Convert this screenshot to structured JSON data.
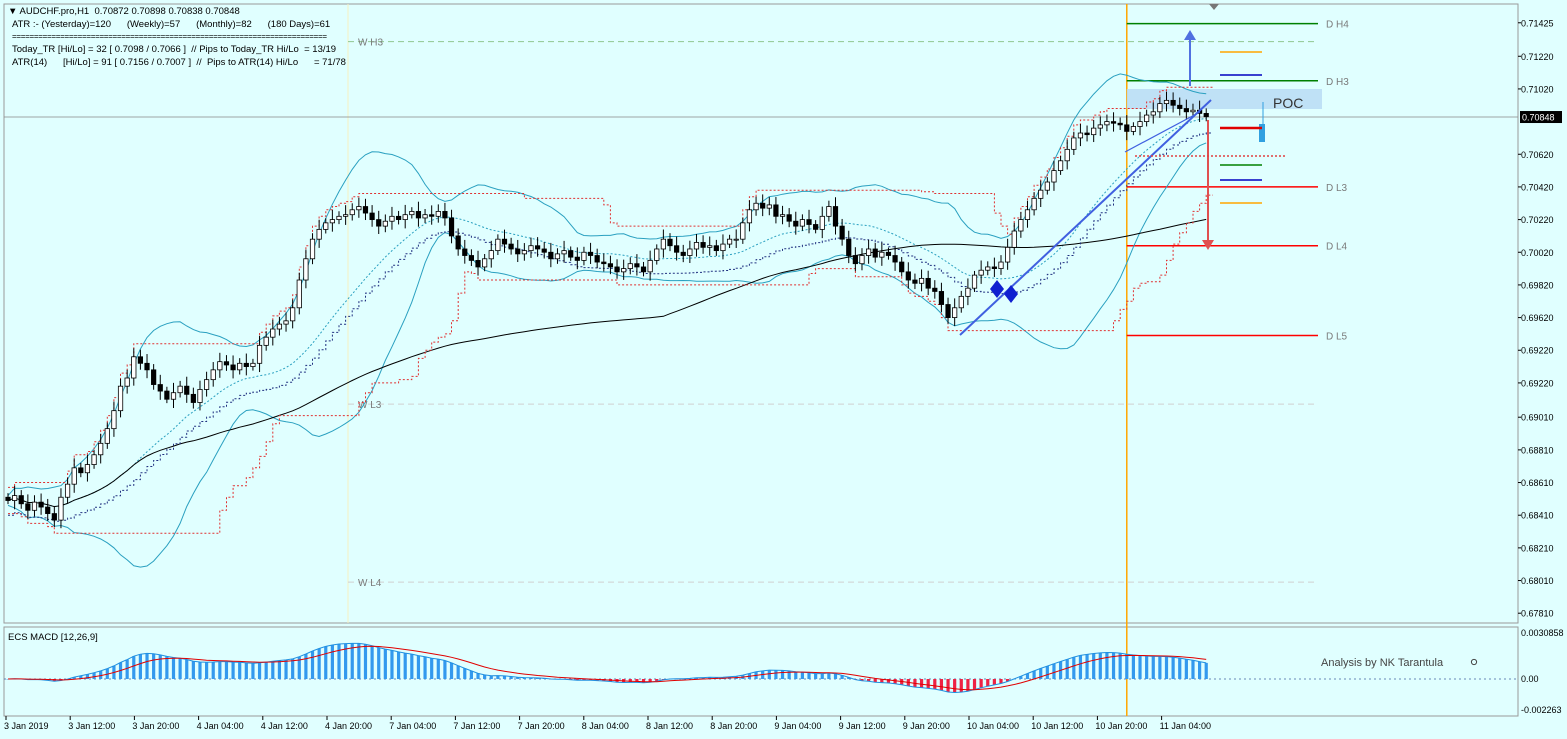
{
  "header": {
    "symbol_line": "AUDCHF.pro,H1  0.70872 0.70898 0.70838 0.70848",
    "atr_line": "ATR :- (Yesterday)=120      (Weekly)=57      (Monthly)=82      (180 Days)=61",
    "separator": "========================================================================",
    "today_tr_line": "Today_TR [Hi/Lo] = 32 [ 0.7098 / 0.7066 ]  // Pips to Today_TR Hi/Lo  = 13/19",
    "atr14_line": "ATR(14)      [Hi/Lo] = 91 [ 0.7156 / 0.7007 ]  //  Pips to ATR(14) Hi/Lo      = 71/78"
  },
  "colors": {
    "background": "#e0ffff",
    "bull_candle": "#ffffff",
    "bear_candle": "#000000",
    "bollinger": "#2aa0c0",
    "envelope_dotted": "#e03030",
    "ma_dark": "#000000",
    "pivot_green": "#008000",
    "pivot_red": "#ff0000",
    "vline_orange": "#ffa500",
    "trendline": "#4060e0",
    "macd_pos": "#3399ee",
    "macd_neg": "#ee2244",
    "poc_zone": "#b8dcf4"
  },
  "chart_data": [
    {
      "type": "candlestick",
      "symbol": "AUDCHF.pro",
      "timeframe": "H1",
      "ylim": [
        0.6775,
        0.7154
      ],
      "y_ticks": [
        0.71425,
        0.7122,
        0.7102,
        0.70848,
        0.7062,
        0.7042,
        0.7022,
        0.7002,
        0.6982,
        0.6962,
        0.6942,
        0.6922,
        0.6901,
        0.6881,
        0.6861,
        0.6841,
        0.6821,
        0.6801,
        0.6781
      ],
      "y_tick_labels": [
        "0.71425",
        "0.71220",
        "0.71020",
        "0.70848",
        "0.70620",
        "0.70420",
        "0.70220",
        "0.70020",
        "0.69820",
        "0.69620",
        "0.69220",
        "0.69220",
        "0.69010",
        "0.68810",
        "0.68610",
        "0.68410",
        "0.68210",
        "0.68010",
        "0.67810"
      ],
      "current_price_label": "0.70848",
      "x_labels": [
        "3 Jan 2019",
        "3 Jan 12:00",
        "3 Jan 20:00",
        "4 Jan 04:00",
        "4 Jan 12:00",
        "4 Jan 20:00",
        "7 Jan 04:00",
        "7 Jan 12:00",
        "7 Jan 20:00",
        "8 Jan 04:00",
        "8 Jan 12:00",
        "8 Jan 20:00",
        "9 Jan 04:00",
        "9 Jan 12:00",
        "9 Jan 20:00",
        "10 Jan 04:00",
        "10 Jan 12:00",
        "10 Jan 20:00",
        "11 Jan 04:00"
      ],
      "closes": [
        0.685,
        0.6853,
        0.6848,
        0.6844,
        0.6849,
        0.6846,
        0.6842,
        0.6838,
        0.6852,
        0.686,
        0.687,
        0.6867,
        0.6872,
        0.6878,
        0.6885,
        0.6894,
        0.6905,
        0.692,
        0.6925,
        0.6938,
        0.6934,
        0.693,
        0.6921,
        0.6917,
        0.6912,
        0.6916,
        0.692,
        0.6915,
        0.691,
        0.6918,
        0.6924,
        0.693,
        0.6935,
        0.6933,
        0.693,
        0.6934,
        0.6932,
        0.6934,
        0.6945,
        0.695,
        0.6955,
        0.6958,
        0.696,
        0.6968,
        0.6985,
        0.6998,
        0.701,
        0.7016,
        0.702,
        0.7022,
        0.7024,
        0.7025,
        0.7028,
        0.703,
        0.7026,
        0.7022,
        0.7018,
        0.7021,
        0.7024,
        0.7022,
        0.7025,
        0.7027,
        0.7023,
        0.7025,
        0.7024,
        0.7027,
        0.7023,
        0.7012,
        0.7004,
        0.7,
        0.6997,
        0.6993,
        0.6998,
        0.7003,
        0.701,
        0.7007,
        0.7004,
        0.7001,
        0.7003,
        0.7006,
        0.7004,
        0.7002,
        0.6998,
        0.7001,
        0.7003,
        0.6999,
        0.6997,
        0.7002,
        0.7,
        0.6996,
        0.6995,
        0.6993,
        0.699,
        0.6992,
        0.6995,
        0.6993,
        0.699,
        0.6997,
        0.7004,
        0.701,
        0.7006,
        0.7002,
        0.7,
        0.7004,
        0.7008,
        0.7005,
        0.7006,
        0.7003,
        0.7007,
        0.701,
        0.701,
        0.702,
        0.7028,
        0.7032,
        0.7029,
        0.7031,
        0.7024,
        0.7025,
        0.7021,
        0.7018,
        0.7022,
        0.7019,
        0.7016,
        0.7024,
        0.703,
        0.7018,
        0.701,
        0.7,
        0.6995,
        0.7,
        0.7004,
        0.6999,
        0.7002,
        0.7,
        0.6996,
        0.699,
        0.6985,
        0.6983,
        0.6986,
        0.698,
        0.6978,
        0.697,
        0.6962,
        0.6968,
        0.6975,
        0.698,
        0.6988,
        0.6991,
        0.6993,
        0.6992,
        0.6996,
        0.7005,
        0.7015,
        0.7022,
        0.7028,
        0.7035,
        0.704,
        0.7045,
        0.7052,
        0.7058,
        0.7065,
        0.7072,
        0.7075,
        0.7074,
        0.7078,
        0.708,
        0.7082,
        0.7081,
        0.708,
        0.7076,
        0.7079,
        0.7082,
        0.7086,
        0.7088,
        0.7093,
        0.7095,
        0.7092,
        0.709,
        0.7088,
        0.7089,
        0.7087,
        0.7085
      ]
    },
    {
      "type": "price_levels",
      "levels": [
        {
          "label": "D H4",
          "value": 0.7142,
          "color": "#008000"
        },
        {
          "label": "D H3",
          "value": 0.7107,
          "color": "#008000"
        },
        {
          "label": "D L3",
          "value": 0.7042,
          "color": "#ff0000"
        },
        {
          "label": "D L4",
          "value": 0.7006,
          "color": "#ff0000"
        },
        {
          "label": "D L5",
          "value": 0.6951,
          "color": "#ff0000"
        },
        {
          "label": "W H3",
          "value": 0.7131,
          "color": "#90c890"
        },
        {
          "label": "W L3",
          "value": 0.6909,
          "color": "#d0d0d0"
        },
        {
          "label": "W L4",
          "value": 0.68,
          "color": "#d0d0d0"
        }
      ],
      "annotation": "POC"
    },
    {
      "type": "macd",
      "title": "ECS MACD [12,26,9]",
      "y_tick_labels": [
        "0.0030858",
        "0.00",
        "-0.002263"
      ],
      "footer": "Analysis by NK Tarantula"
    }
  ]
}
